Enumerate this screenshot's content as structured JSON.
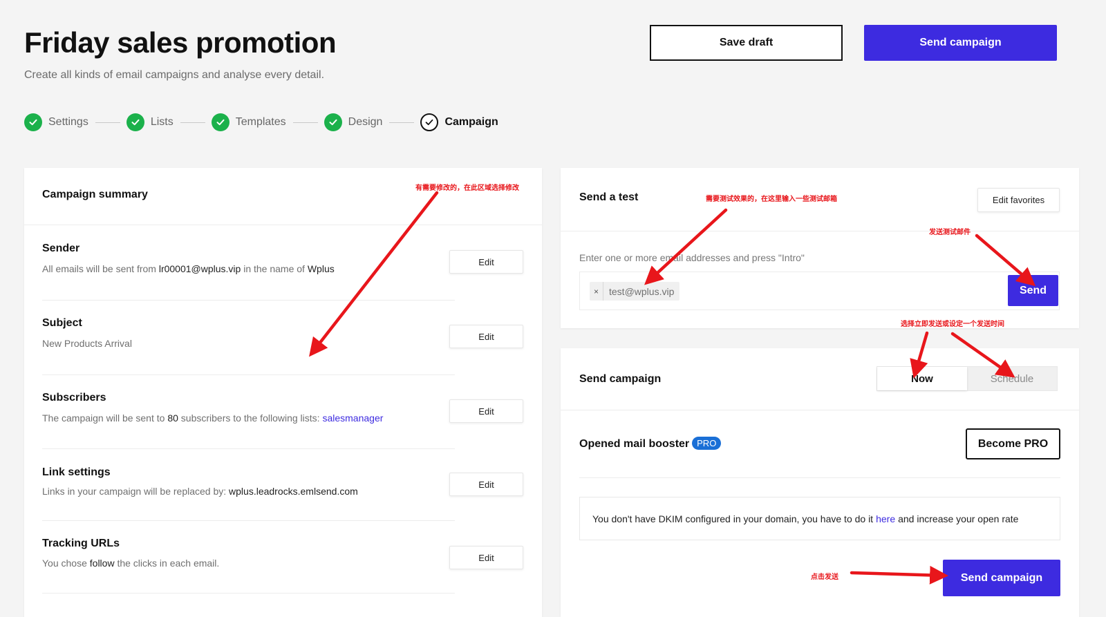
{
  "header": {
    "title": "Friday sales promotion",
    "subtitle": "Create all kinds of email campaigns and analyse every detail.",
    "save_draft_label": "Save draft",
    "send_campaign_label": "Send campaign"
  },
  "steps": [
    {
      "label": "Settings",
      "status": "done"
    },
    {
      "label": "Lists",
      "status": "done"
    },
    {
      "label": "Templates",
      "status": "done"
    },
    {
      "label": "Design",
      "status": "done"
    },
    {
      "label": "Campaign",
      "status": "current"
    }
  ],
  "summary": {
    "title": "Campaign summary",
    "edit_label": "Edit",
    "sender": {
      "title": "Sender",
      "desc_prefix": "All emails will be sent from",
      "email": "lr00001@wplus.vip",
      "desc_mid": "in the name of",
      "name": "Wplus"
    },
    "subject": {
      "title": "Subject",
      "value": "New Products Arrival"
    },
    "subscribers": {
      "title": "Subscribers",
      "desc_prefix": "The campaign will be sent to",
      "count": "80",
      "desc_mid": "subscribers to the following lists:",
      "list": "salesmanager"
    },
    "link_settings": {
      "title": "Link settings",
      "desc_prefix": "Links in your campaign will be replaced by:",
      "domain": "wplus.leadrocks.emlsend.com"
    },
    "tracking": {
      "title": "Tracking URLs",
      "desc_prefix": "You chose",
      "mode": "follow",
      "desc_suffix": "the clicks in each email."
    }
  },
  "send_test": {
    "title": "Send a test",
    "edit_favorites_label": "Edit favorites",
    "hint": "Enter one or more email addresses and press \"Intro\"",
    "tag_remove": "×",
    "tag_email": "test@wplus.vip",
    "send_label": "Send"
  },
  "send_campaign": {
    "title": "Send campaign",
    "now_label": "Now",
    "schedule_label": "Schedule",
    "booster_label": "Opened mail booster",
    "pro_badge": "PRO",
    "become_pro_label": "Become PRO",
    "dkim_prefix": "You don't have DKIM configured in your domain, you have to do it",
    "dkim_link": "here",
    "dkim_suffix": "and increase your open rate",
    "send_button_label": "Send campaign"
  },
  "annotations": {
    "edit_area": "有需要修改的，在此区域选择修改",
    "test_email": "需要测试效果的，在这里输入一些测试邮箱",
    "send_test": "发送测试邮件",
    "now_or_schedule": "选择立即发送或设定一个发送时间",
    "click_send": "点击发送"
  },
  "colors": {
    "primary": "#3d2be0",
    "success": "#1bb14b",
    "annotation": "#e8161b",
    "pro_badge": "#1a6fd6"
  }
}
